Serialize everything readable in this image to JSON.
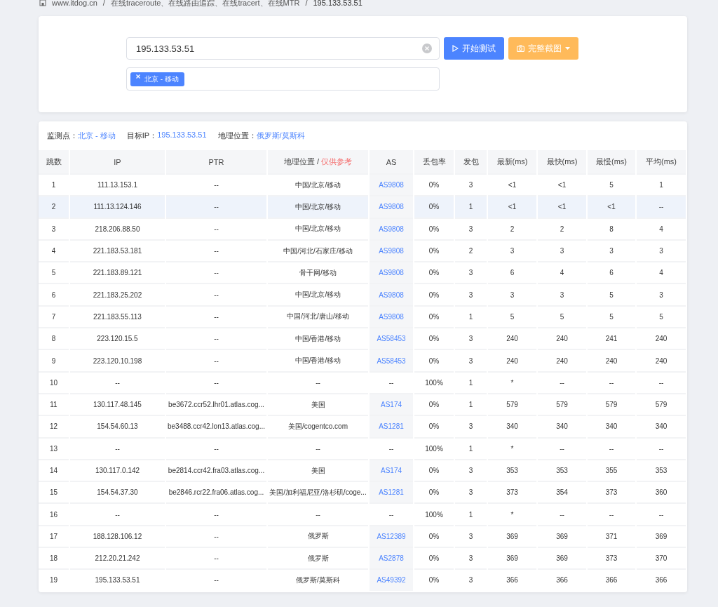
{
  "breadcrumb": [
    "www.itdog.cn",
    "/",
    "在线traceroute、在线路由追踪、在线tracert、在线MTR",
    "/",
    "195.133.53.51"
  ],
  "search": {
    "value": "195.133.53.51",
    "tags": [
      "北京 - 移动"
    ],
    "start_button": "开始测试",
    "screenshot_button": "完整截图"
  },
  "summary": [
    {
      "label": "监测点：",
      "value": "北京 - 移动"
    },
    {
      "label": "目标IP：",
      "value": "195.133.53.51"
    },
    {
      "label": "地理位置：",
      "value": "俄罗斯/莫斯科"
    }
  ],
  "table": {
    "columns": [
      {
        "label": "跳数"
      },
      {
        "label": "IP"
      },
      {
        "label": "PTR"
      },
      {
        "label": "地理位置 / ",
        "note": "仅供参考"
      },
      {
        "label": "AS"
      },
      {
        "label": "丢包率"
      },
      {
        "label": "发包"
      },
      {
        "label": "最新(ms)"
      },
      {
        "label": "最快(ms)"
      },
      {
        "label": "最慢(ms)"
      },
      {
        "label": "平均(ms)"
      }
    ],
    "rows": [
      {
        "selected": false,
        "kind": "reply",
        "cells": [
          "1",
          "111.13.153.1",
          "--",
          "中国/北京/移动",
          "AS9808",
          "0%",
          "3",
          "<1",
          "<1",
          "5",
          "1"
        ]
      },
      {
        "selected": true,
        "kind": "reply",
        "cells": [
          "2",
          "111.13.124.146",
          "--",
          "中国/北京/移动",
          "AS9808",
          "0%",
          "1",
          "<1",
          "<1",
          "<1",
          "--"
        ]
      },
      {
        "selected": false,
        "kind": "reply",
        "cells": [
          "3",
          "218.206.88.50",
          "--",
          "中国/北京/移动",
          "AS9808",
          "0%",
          "3",
          "2",
          "2",
          "8",
          "4"
        ]
      },
      {
        "selected": false,
        "kind": "reply",
        "cells": [
          "4",
          "221.183.53.181",
          "--",
          "中国/河北/石家庄/移动",
          "AS9808",
          "0%",
          "2",
          "3",
          "3",
          "3",
          "3"
        ]
      },
      {
        "selected": false,
        "kind": "reply",
        "cells": [
          "5",
          "221.183.89.121",
          "--",
          "骨干网/移动",
          "AS9808",
          "0%",
          "3",
          "6",
          "4",
          "6",
          "4"
        ]
      },
      {
        "selected": false,
        "kind": "reply",
        "cells": [
          "6",
          "221.183.25.202",
          "--",
          "中国/北京/移动",
          "AS9808",
          "0%",
          "3",
          "3",
          "3",
          "5",
          "3"
        ]
      },
      {
        "selected": false,
        "kind": "reply",
        "cells": [
          "7",
          "221.183.55.113",
          "--",
          "中国/河北/唐山/移动",
          "AS9808",
          "0%",
          "1",
          "5",
          "5",
          "5",
          "5"
        ]
      },
      {
        "selected": false,
        "kind": "reply",
        "cells": [
          "8",
          "223.120.15.5",
          "--",
          "中国/香港/移动",
          "AS58453",
          "0%",
          "3",
          "240",
          "240",
          "241",
          "240"
        ]
      },
      {
        "selected": false,
        "kind": "reply",
        "cells": [
          "9",
          "223.120.10.198",
          "--",
          "中国/香港/移动",
          "AS58453",
          "0%",
          "3",
          "240",
          "240",
          "240",
          "240"
        ]
      },
      {
        "selected": false,
        "kind": "timeout",
        "cells": [
          "10",
          "--",
          "--",
          "--",
          "--",
          "100%",
          "1",
          "*",
          "--",
          "--",
          "--"
        ]
      },
      {
        "selected": false,
        "kind": "reply",
        "cells": [
          "11",
          "130.117.48.145",
          "be3672.ccr52.lhr01.atlas.cog...",
          "美国",
          "AS174",
          "0%",
          "1",
          "579",
          "579",
          "579",
          "579"
        ]
      },
      {
        "selected": false,
        "kind": "reply",
        "cells": [
          "12",
          "154.54.60.13",
          "be3488.ccr42.lon13.atlas.cog...",
          "美国/cogentco.com",
          "AS1281",
          "0%",
          "3",
          "340",
          "340",
          "340",
          "340"
        ]
      },
      {
        "selected": false,
        "kind": "timeout",
        "cells": [
          "13",
          "--",
          "--",
          "--",
          "--",
          "100%",
          "1",
          "*",
          "--",
          "--",
          "--"
        ]
      },
      {
        "selected": false,
        "kind": "reply",
        "cells": [
          "14",
          "130.117.0.142",
          "be2814.ccr42.fra03.atlas.cog...",
          "美国",
          "AS174",
          "0%",
          "3",
          "353",
          "353",
          "355",
          "353"
        ]
      },
      {
        "selected": false,
        "kind": "reply",
        "cells": [
          "15",
          "154.54.37.30",
          "be2846.rcr22.fra06.atlas.cog...",
          "美国/加利福尼亚/洛杉矶/coge...",
          "AS1281",
          "0%",
          "3",
          "373",
          "354",
          "373",
          "360"
        ]
      },
      {
        "selected": false,
        "kind": "timeout",
        "cells": [
          "16",
          "--",
          "--",
          "--",
          "--",
          "100%",
          "1",
          "*",
          "--",
          "--",
          "--"
        ]
      },
      {
        "selected": false,
        "kind": "reply",
        "cells": [
          "17",
          "188.128.106.12",
          "--",
          "俄罗斯",
          "AS12389",
          "0%",
          "3",
          "369",
          "369",
          "371",
          "369"
        ]
      },
      {
        "selected": false,
        "kind": "reply",
        "cells": [
          "18",
          "212.20.21.242",
          "--",
          "俄罗斯",
          "AS2878",
          "0%",
          "3",
          "369",
          "369",
          "373",
          "370"
        ]
      },
      {
        "selected": false,
        "kind": "reply",
        "cells": [
          "19",
          "195.133.53.51",
          "--",
          "俄罗斯/莫斯科",
          "AS49392",
          "0%",
          "3",
          "366",
          "366",
          "366",
          "366"
        ]
      }
    ]
  }
}
